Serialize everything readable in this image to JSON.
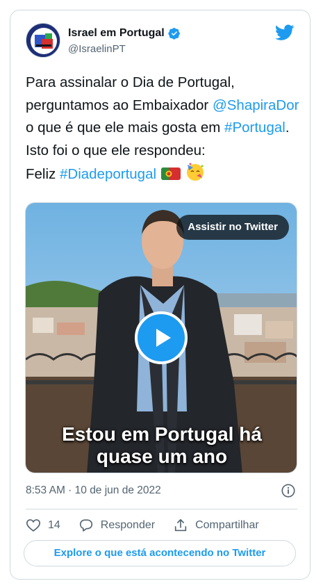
{
  "author": {
    "name": "Israel em Portugal",
    "handle": "@IsraelinPT"
  },
  "tweet": {
    "text_1": "Para assinalar o Dia de Portugal, perguntamos ao Embaixador ",
    "mention": "@ShapiraDor",
    "text_2": " o que é que ele mais gosta em ",
    "hashtag_1": "#Portugal",
    "text_3": ". Isto foi o que ele respondeu:",
    "text_4": "Feliz ",
    "hashtag_2": "#Diadeportugal"
  },
  "media": {
    "watch_label": "Assistir no Twitter",
    "caption_line1": "Estou em Portugal há",
    "caption_line2": "quase um ano"
  },
  "timestamp": "8:53 AM · 10 de jun de 2022",
  "actions": {
    "like_count": "14",
    "reply_label": "Responder",
    "share_label": "Compartilhar"
  },
  "explore_label": "Explore o que está acontecendo no Twitter",
  "colors": {
    "accent": "#1d9bf0",
    "text": "#0f1419",
    "muted": "#536471",
    "border": "#cfd9de"
  },
  "icons": [
    "avatar",
    "verified-badge-icon",
    "twitter-bird-icon",
    "portugal-flag-emoji",
    "party-face-emoji",
    "play-icon",
    "info-icon",
    "heart-icon",
    "reply-icon",
    "share-icon"
  ]
}
